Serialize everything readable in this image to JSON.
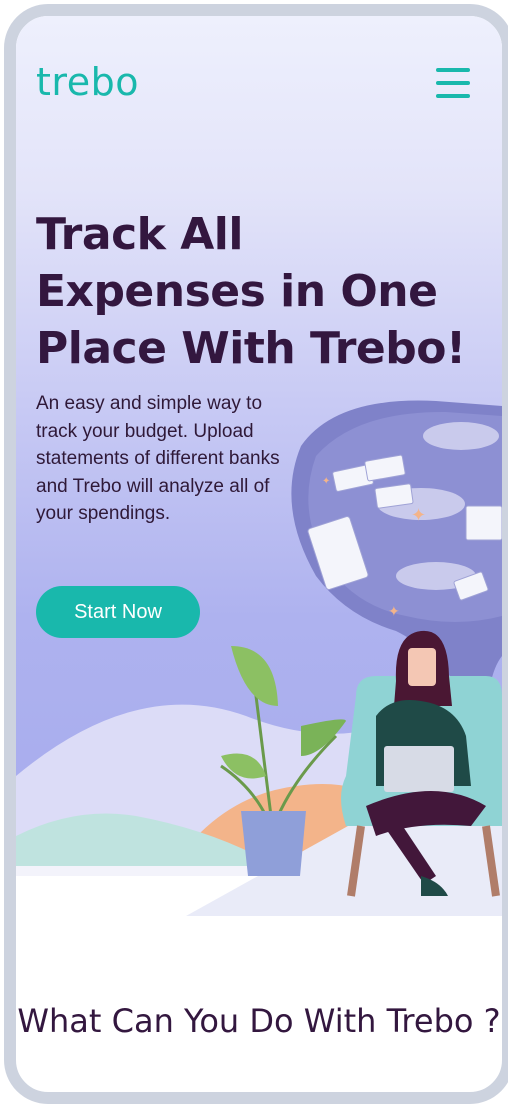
{
  "header": {
    "logo": "trebo",
    "menu_icon": "hamburger-menu-icon"
  },
  "hero": {
    "title": "Track All Expenses in One Place With Trebo!",
    "description": "An easy and simple way to track your budget. Upload statements of different banks and Trebo will analyze all of your spendings.",
    "cta_label": "Start Now",
    "illustration": "woman-with-laptop-thinking-about-money-illustration"
  },
  "features": {
    "heading": "What Can You Do With Trebo ?"
  },
  "colors": {
    "brand": "#19b8ac",
    "heading": "#33173f",
    "hero_gradient_bottom": "#a6abed"
  }
}
